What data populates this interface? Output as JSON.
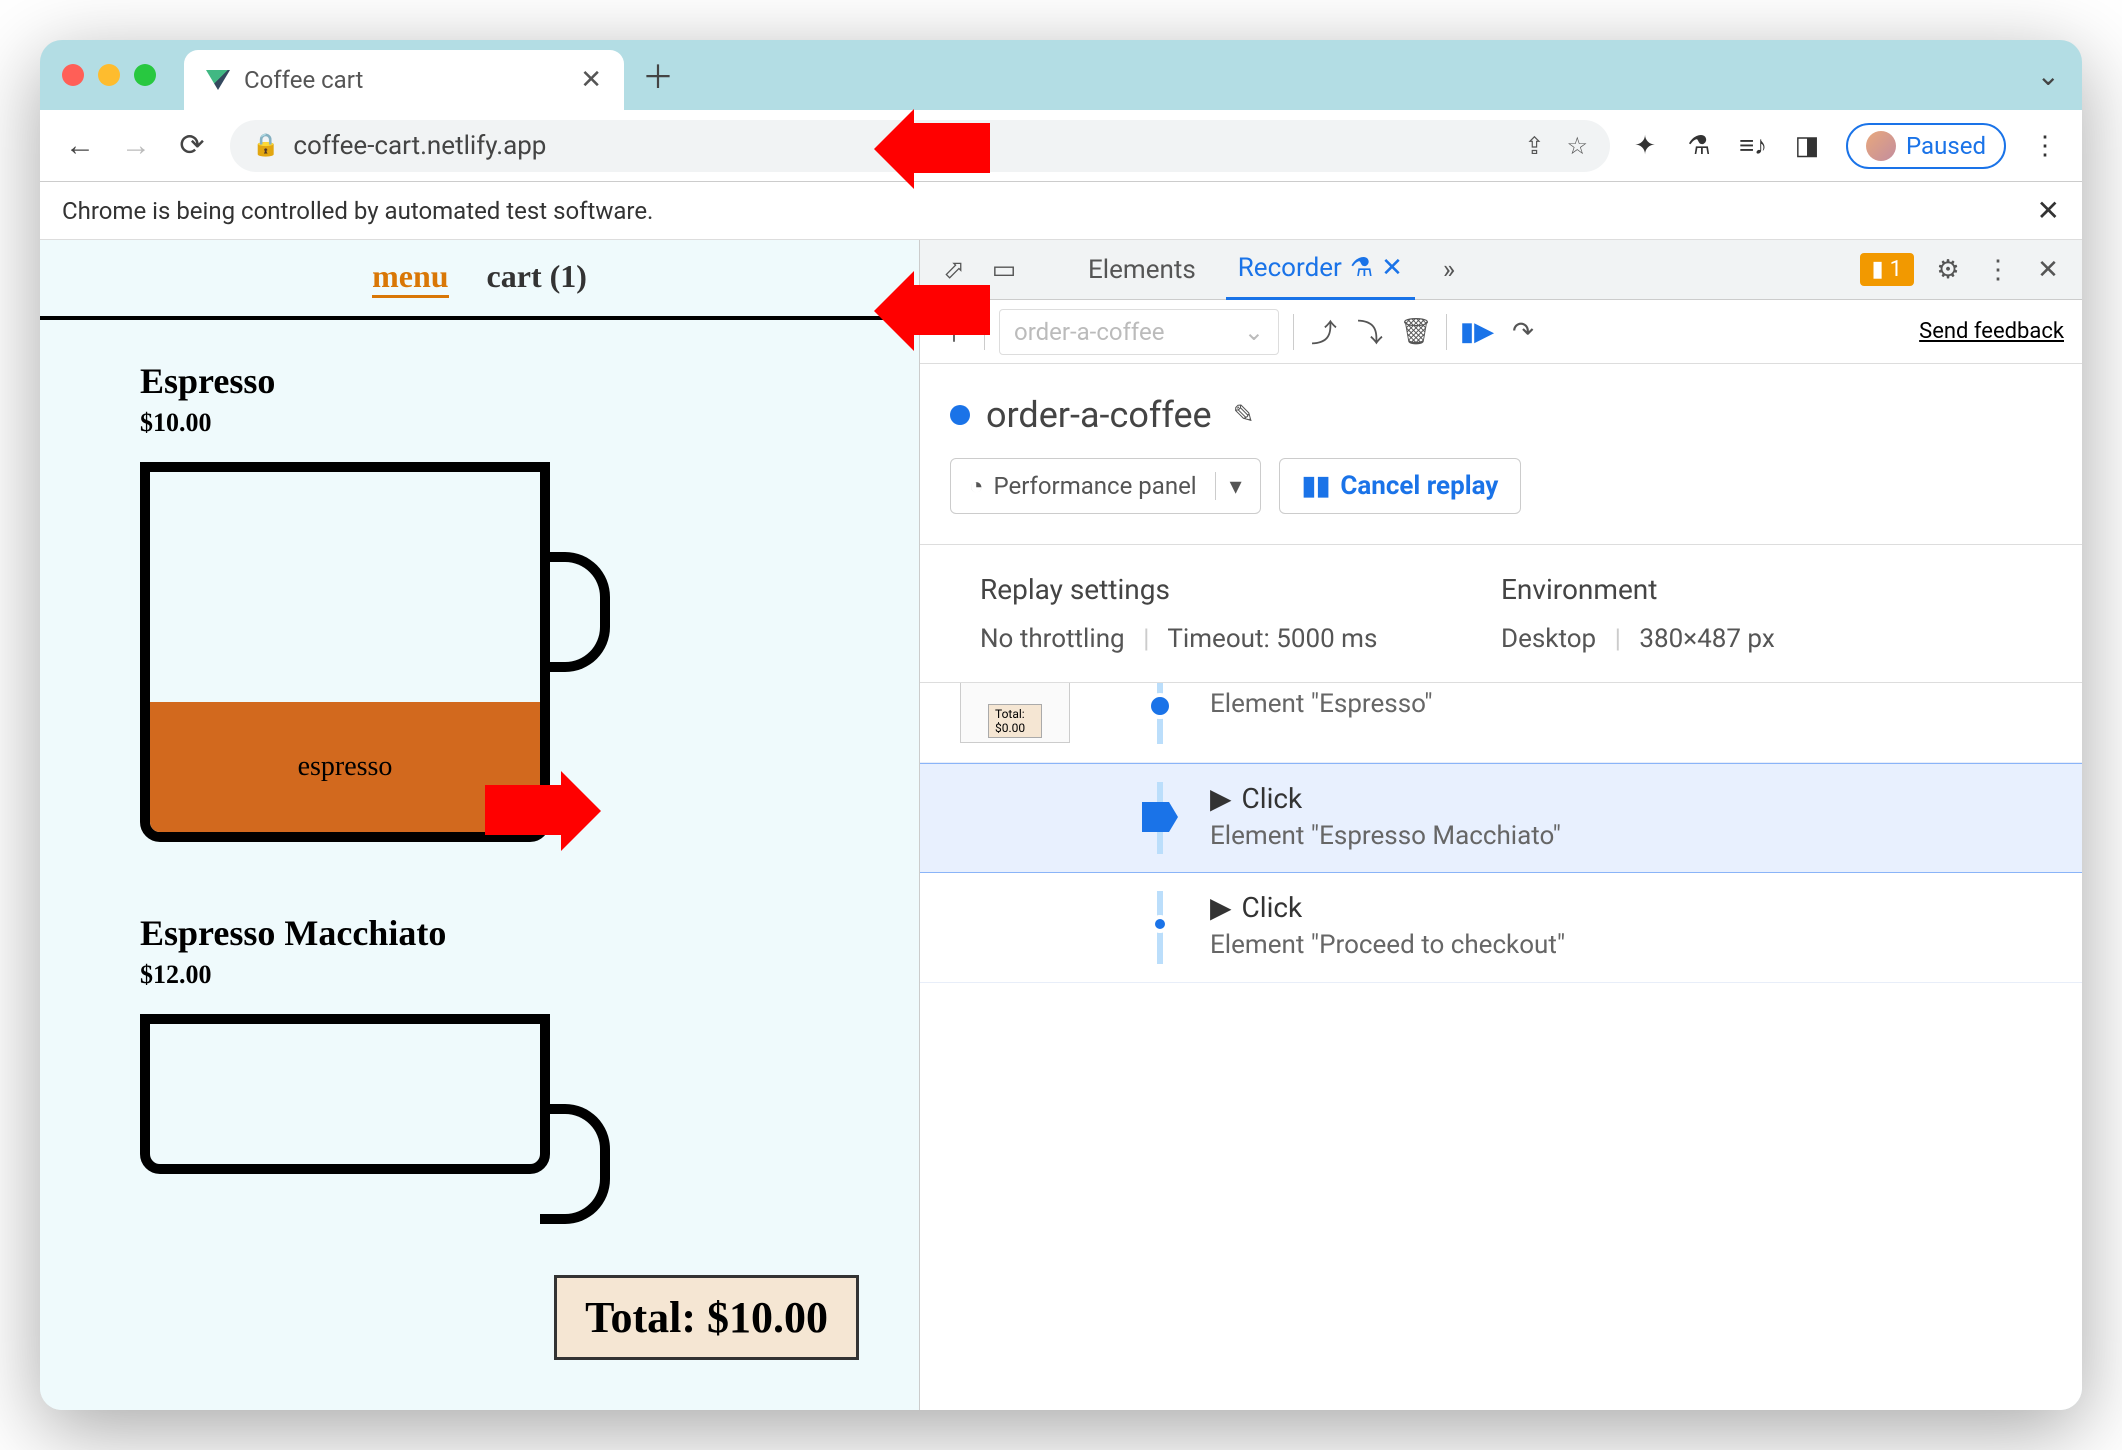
{
  "browser": {
    "tab_title": "Coffee cart",
    "url": "coffee-cart.netlify.app",
    "automation_banner": "Chrome is being controlled by automated test software.",
    "paused_label": "Paused"
  },
  "page": {
    "nav_menu": "menu",
    "nav_cart": "cart (1)",
    "product1_name": "Espresso",
    "product1_price": "$10.00",
    "cup_label": "espresso",
    "product2_name": "Espresso Macchiato",
    "product2_price": "$12.00",
    "total_label": "Total: $10.00"
  },
  "devtools": {
    "tabs": {
      "elements": "Elements",
      "recorder": "Recorder"
    },
    "issues_count": "1",
    "recording_name_placeholder": "order-a-coffee",
    "send_feedback": "Send feedback",
    "recording_title": "order-a-coffee",
    "performance_panel": "Performance panel",
    "cancel_replay": "Cancel replay",
    "replay_settings_heading": "Replay settings",
    "replay_throttling": "No throttling",
    "replay_timeout": "Timeout: 5000 ms",
    "environment_heading": "Environment",
    "env_device": "Desktop",
    "env_viewport": "380×487 px",
    "step0_elem": "Element \"Espresso\"",
    "step0_thumb": "Total: $0.00",
    "step1_title": "Click",
    "step1_elem": "Element \"Espresso Macchiato\"",
    "step2_title": "Click",
    "step2_elem": "Element \"Proceed to checkout\""
  }
}
